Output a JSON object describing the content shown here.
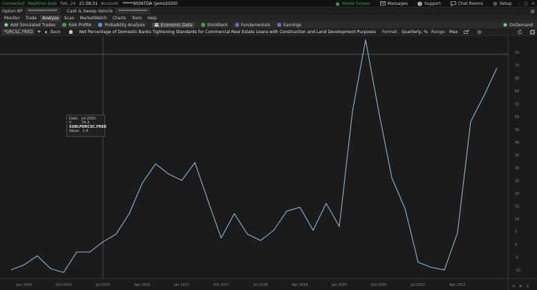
{
  "status": {
    "connected": "Connected",
    "realtime": "Realtime data",
    "date": "Feb, 24",
    "time": "21:58:31",
    "account_label": "Account:",
    "account_value": "*****9036TDA (jamo2020)",
    "home_screen": "Home Screen",
    "messages": "Messages",
    "support": "Support",
    "chat_rooms": "Chat Rooms",
    "setup": "Setup"
  },
  "account": {
    "option_bp_label": "Option BP",
    "option_bp_value": "**************",
    "cash_sweep_label": "Cash & Sweep Vehicle",
    "cash_sweep_value": "**************"
  },
  "menu": [
    "Monitor",
    "Trade",
    "Analyze",
    "Scan",
    "MarketWatch",
    "Charts",
    "Tools",
    "Help"
  ],
  "toolbar": {
    "add_simulated": "Add Simulated Trades",
    "risk_profile": "Risk Profile",
    "probability": "Probability Analysis",
    "economic_data": "Economic Data",
    "thinkback": "thinkBack",
    "fundamentals": "Fundamentals",
    "earnings": "Earnings",
    "ondemand": "OnDemand"
  },
  "chart_header": {
    "symbol": "*DRCSC.FRED",
    "back": "Back",
    "title": "Net Percentage of Domestic Banks Tightening Standards for Commercial Real Estate Loans with Construction and Land Development Purposes",
    "format_label": "Format:",
    "format_value": "Quarterly, %",
    "range_label": "Range:",
    "range_value": "Max"
  },
  "tooltip": {
    "date_label": "Date:",
    "date_value": "Jul 2015",
    "y_label": "Y:",
    "y_value": "74.3",
    "series": "SUBLPDRCSC.FRED",
    "value_label": "Value:",
    "value_value": "1.4"
  },
  "colors": {
    "line": "#8fb7d6",
    "background": "#1b1b1b",
    "grid": "#2e2e2e",
    "green": "#3aa34d"
  },
  "chart_data": {
    "type": "line",
    "series": [
      {
        "values": [
          -10,
          -8,
          -4.5,
          -9.5,
          -11,
          -3,
          -3,
          1,
          4,
          12,
          24,
          31.5,
          27.5,
          25,
          32,
          17,
          2.5,
          12,
          4,
          1.5,
          5.5,
          13,
          14.5,
          5.5,
          16,
          7,
          52,
          80,
          52,
          26,
          14,
          -7,
          -9,
          -10,
          4.5,
          48,
          58,
          69
        ]
      }
    ],
    "x_ticks": [
      "Jan 2014",
      "Oct 2014",
      "Jul 2015",
      "Apr 2016",
      "Jan 2017",
      "Oct 2017",
      "Jul 2018",
      "Apr 2019",
      "Jan 2020",
      "Oct 2020",
      "Jul 2021",
      "Apr 2022"
    ],
    "y_ticks": [
      "-10",
      "-5",
      "0",
      "5",
      "10",
      "15",
      "20",
      "25",
      "30",
      "35",
      "40",
      "45",
      "50",
      "55",
      "60",
      "65",
      "70",
      "75"
    ],
    "ylim": [
      -13,
      81
    ],
    "crosshair_x": "Jul 2015",
    "crosshair_y": 74.3
  }
}
